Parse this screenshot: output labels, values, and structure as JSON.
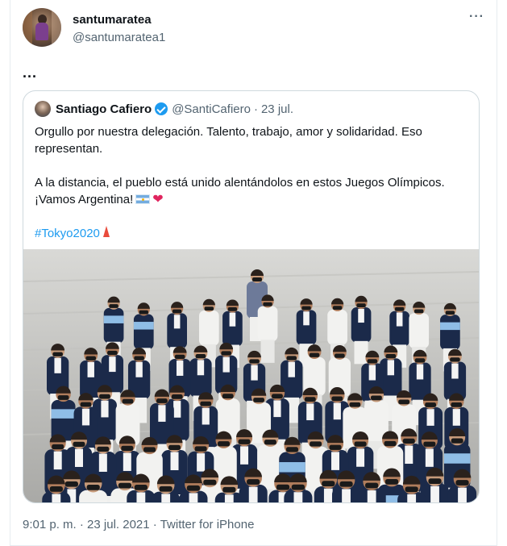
{
  "tweet": {
    "author": {
      "display_name": "santumaratea",
      "handle": "@santumaratea1"
    },
    "more_icon": "more-horizontal-icon",
    "text": "...",
    "meta": {
      "time": "9:01 p. m.",
      "separator": "·",
      "date": "23 jul. 2021",
      "source": "Twitter for iPhone"
    }
  },
  "quote": {
    "author": {
      "name": "Santiago Cafiero",
      "handle": "@SantiCafiero",
      "dot": "·",
      "date": "23 jul.",
      "verified": true
    },
    "lines": {
      "p1": "Orgullo por nuestra delegación. Talento, trabajo, amor y solidaridad. Eso representan.",
      "p2a": "A la distancia, el pueblo está unido alentándolos en estos Juegos Olímpicos.",
      "p2b": "¡Vamos Argentina!",
      "hashtag": "#Tokyo2020"
    },
    "emoji": [
      "argentina-flag",
      "red-heart",
      "tokyo-tower"
    ],
    "colors": {
      "link": "#1d9bf0",
      "text": "#0f1419",
      "muted": "#536471",
      "heart": "#e0245e",
      "navy_blazer": "#1b2a4a"
    }
  }
}
